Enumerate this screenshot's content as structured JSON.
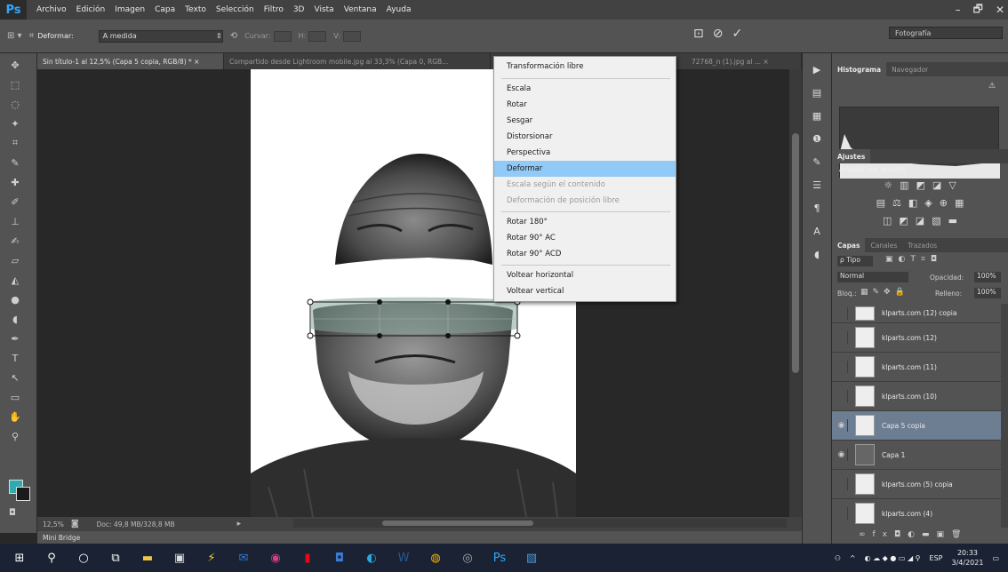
{
  "app": {
    "logo": "Ps",
    "menu": [
      "Archivo",
      "Edición",
      "Imagen",
      "Capa",
      "Texto",
      "Selección",
      "Filtro",
      "3D",
      "Vista",
      "Ventana",
      "Ayuda"
    ],
    "window_controls": [
      "–",
      "🗗",
      "✕"
    ]
  },
  "options": {
    "warp_label": "Deformar:",
    "warp_value": "A medida",
    "fields": [
      {
        "label": "Curvar:",
        "value": ""
      },
      {
        "label": "H:",
        "value": ""
      },
      {
        "label": "V:",
        "value": ""
      }
    ],
    "workspace": "Fotografía"
  },
  "doc_tabs": [
    "Sin título-1 al 12,5% (Capa 5 copia, RGB/8) * ×",
    "Compartido desde Lightroom mobile.jpg al 33,3% (Capa 0, RGB...",
    "72768_n (1).jpg al ... ×"
  ],
  "context_menu": {
    "items": [
      {
        "label": "Transformación libre",
        "state": "normal"
      },
      {
        "label": "Escala",
        "state": "normal"
      },
      {
        "label": "Rotar",
        "state": "normal"
      },
      {
        "label": "Sesgar",
        "state": "normal"
      },
      {
        "label": "Distorsionar",
        "state": "normal"
      },
      {
        "label": "Perspectiva",
        "state": "normal"
      },
      {
        "label": "Deformar",
        "state": "hover"
      },
      {
        "label": "Escala según el contenido",
        "state": "disabled"
      },
      {
        "label": "Deformación de posición libre",
        "state": "disabled"
      },
      {
        "label": "Rotar 180°",
        "state": "normal"
      },
      {
        "label": "Rotar 90° AC",
        "state": "normal"
      },
      {
        "label": "Rotar 90° ACD",
        "state": "normal"
      },
      {
        "label": "Voltear horizontal",
        "state": "normal"
      },
      {
        "label": "Voltear vertical",
        "state": "normal"
      }
    ]
  },
  "status": {
    "zoom": "12,5%",
    "doc": "Doc: 49,8 MB/328,8 MB",
    "mini_bridge": "Mini Bridge"
  },
  "panels": {
    "histogram_tabs": [
      "Histograma",
      "Navegador"
    ],
    "adjust_tabs": [
      "Ajustes"
    ],
    "adjust_title": "Añadir un ajuste",
    "adjust_rows": [
      [
        "☼",
        "▥",
        "◩",
        "◪",
        "▽"
      ],
      [
        "▤",
        "⚖",
        "◧",
        "◈",
        "⊕",
        "▦"
      ],
      [
        "◫",
        "◩",
        "◪",
        "▧",
        "▬"
      ]
    ],
    "layers_tabs": [
      "Capas",
      "Canales",
      "Trazados"
    ],
    "filter_label": "ρ Tipo",
    "blend_mode": "Normal",
    "opacity_label": "Opacidad:",
    "opacity_value": "100%",
    "lock_label": "Bloq.:",
    "fill_label": "Relleno:",
    "fill_value": "100%",
    "layers": [
      {
        "name": "klparts.com (12) copia",
        "visible": false,
        "selected": false
      },
      {
        "name": "klparts.com (12)",
        "visible": false,
        "selected": false
      },
      {
        "name": "klparts.com (11)",
        "visible": false,
        "selected": false
      },
      {
        "name": "klparts.com (10)",
        "visible": false,
        "selected": false
      },
      {
        "name": "Capa 5 copia",
        "visible": true,
        "selected": true
      },
      {
        "name": "Capa 1",
        "visible": true,
        "selected": false
      },
      {
        "name": "klparts.com (5) copia",
        "visible": false,
        "selected": false
      },
      {
        "name": "klparts.com (4)",
        "visible": false,
        "selected": false
      }
    ]
  },
  "taskbar": {
    "language": "ESP",
    "time": "20:33",
    "date": "3/4/2021"
  }
}
